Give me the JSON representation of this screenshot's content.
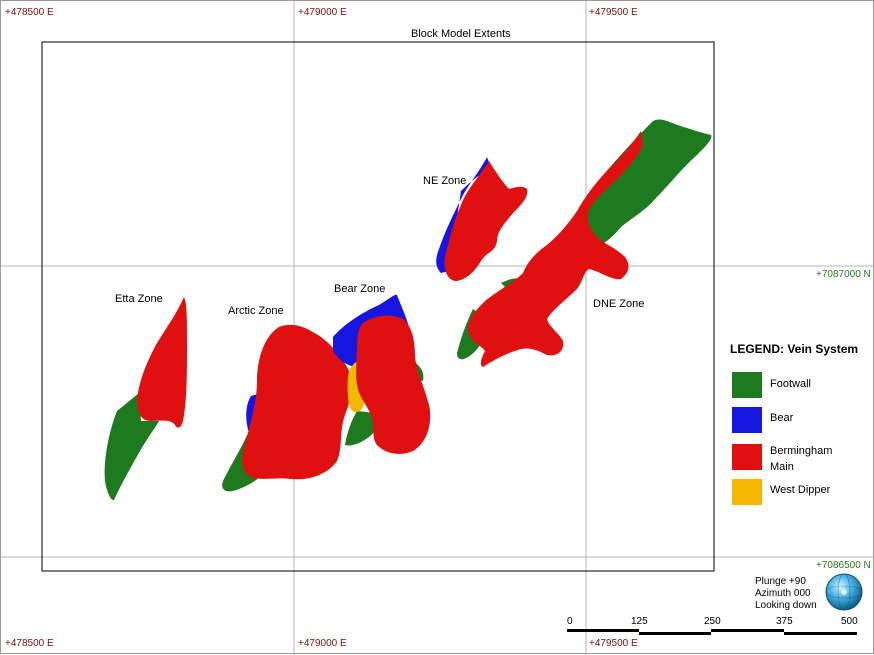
{
  "map": {
    "block_title": "Block Model Extents",
    "coords": {
      "top": [
        "+478500 E",
        "+479000 E",
        "+479500 E"
      ],
      "bottom": [
        "+478500 E",
        "+479000 E",
        "+479500 E"
      ],
      "right": [
        "+7087000 N",
        "+7086500 N"
      ]
    },
    "zones": [
      "NE Zone",
      "Etta Zone",
      "Arctic Zone",
      "Bear Zone",
      "DNE Zone"
    ]
  },
  "legend": {
    "title": "LEGEND: Vein System",
    "items": [
      {
        "label_lines": [
          "Footwall"
        ],
        "color": "#1e7a1e"
      },
      {
        "label_lines": [
          "Bear"
        ],
        "color": "#1616e0"
      },
      {
        "label_lines": [
          "Bermingham",
          "Main"
        ],
        "color": "#e01010"
      },
      {
        "label_lines": [
          "West Dipper"
        ],
        "color": "#f5b800"
      }
    ]
  },
  "view": {
    "plunge": "Plunge +90",
    "azimuth": "Azimuth 000",
    "looking": "Looking down"
  },
  "scale_bar": {
    "labels": [
      "0",
      "125",
      "250",
      "375",
      "500"
    ]
  },
  "colors": {
    "footwall": "#1e7a1e",
    "bear": "#1616e0",
    "bermingham": "#e01010",
    "west_dipper": "#f5b800",
    "grid": "#b4b4b4"
  }
}
